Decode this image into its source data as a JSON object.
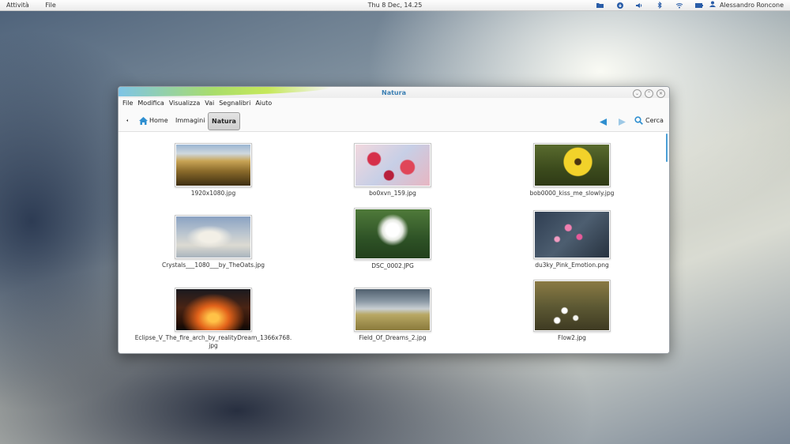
{
  "topbar": {
    "activities": "Attività",
    "app_menu": "File",
    "clock": "Thu  8 Dec, 14.25",
    "user": "Alessandro Roncone",
    "tray_icons": [
      "folder-icon",
      "update-icon",
      "volume-icon",
      "bluetooth-icon",
      "wifi-icon",
      "battery-icon",
      "user-icon"
    ]
  },
  "window": {
    "title": "Natura",
    "menu": [
      "File",
      "Modifica",
      "Visualizza",
      "Vai",
      "Segnalibri",
      "Aiuto"
    ],
    "breadcrumb": {
      "home": "Home",
      "immagini": "Immagini",
      "current": "Natura"
    },
    "search_label": "Cerca",
    "colors": {
      "accent": "#3b7fb3",
      "nav_arrow": "#2f8fd0"
    }
  },
  "files": [
    {
      "name": "1920x1080.jpg",
      "thumb": "wheat"
    },
    {
      "name": "bo0xvn_159.jpg",
      "thumb": "red-leaves"
    },
    {
      "name": "bob0000_kiss_me_slowly.jpg",
      "thumb": "yellow-flower"
    },
    {
      "name": "Crystals___1080___by_TheOats.jpg",
      "thumb": "frost-grass"
    },
    {
      "name": "DSC_0002.JPG",
      "thumb": "dandelion"
    },
    {
      "name": "du3ky_Pink_Emotion.png",
      "thumb": "pink-blossom"
    },
    {
      "name": "Eclipse_V_The_fire_arch_by_realityDream_1366x768.\njpg",
      "thumb": "fire-sky"
    },
    {
      "name": "Field_Of_Dreams_2.jpg",
      "thumb": "field"
    },
    {
      "name": "Flow2.jpg",
      "thumb": "white-flowers"
    }
  ]
}
